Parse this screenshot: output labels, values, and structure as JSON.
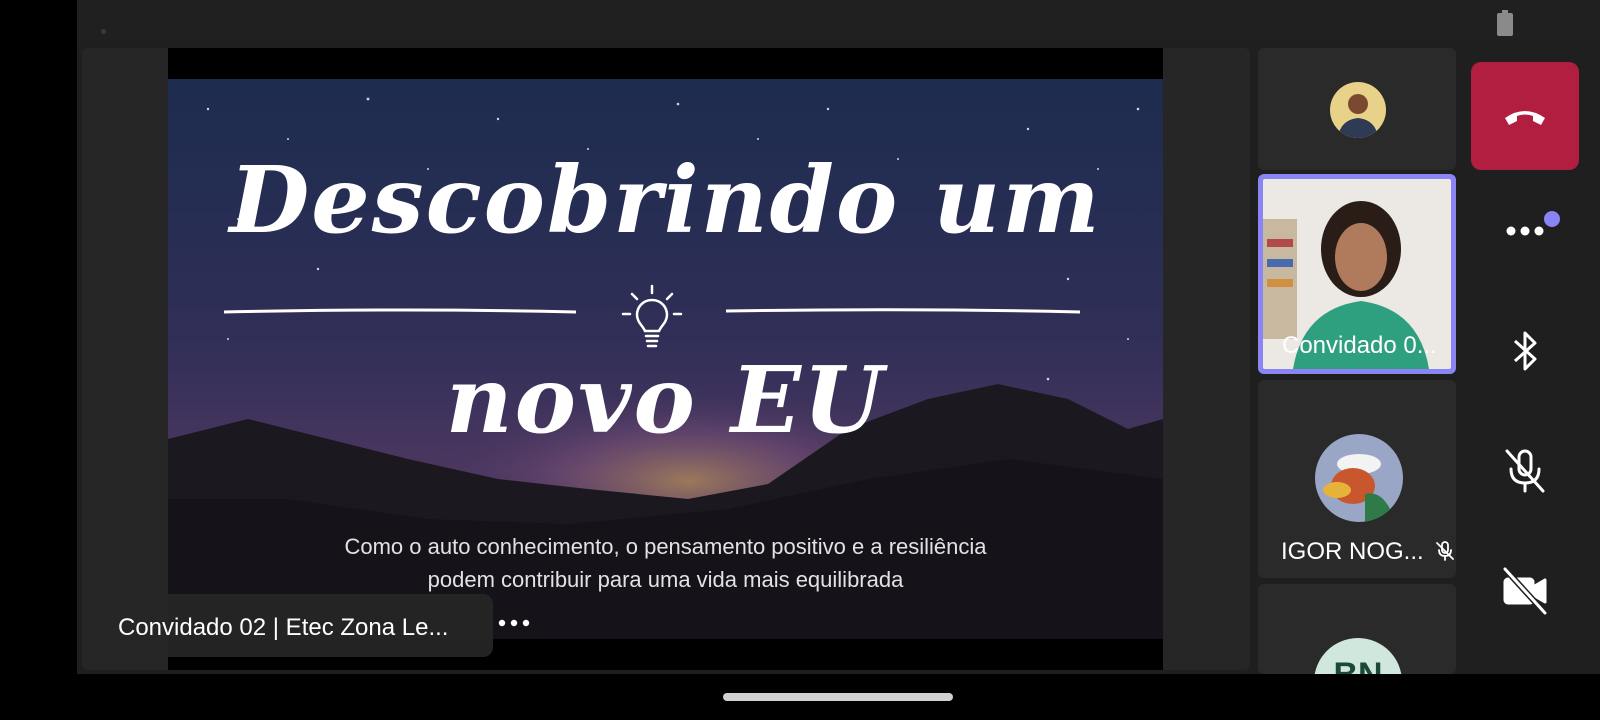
{
  "slide": {
    "title_line1": "Descobrindo um",
    "title_line2": "novo EU",
    "subtitle_line1": "Como o auto conhecimento, o pensamento positivo e a resiliência",
    "subtitle_line2": "podem contribuir para uma vida mais equilibrada",
    "icon": "lightbulb-icon"
  },
  "presenter": {
    "name": "Convidado 02 | Etec Zona Le...",
    "more_icon": "more-horizontal-icon"
  },
  "participants": [
    {
      "name": "",
      "type": "avatar-photo"
    },
    {
      "name": "Convidado 0...",
      "type": "video",
      "active_speaker": true
    },
    {
      "name": "IGOR NOG...",
      "type": "avatar-photo",
      "muted": true
    },
    {
      "name": "",
      "type": "avatar-initials",
      "initials": "BN"
    }
  ],
  "controls": {
    "hangup_icon": "phone-hangup-icon",
    "more_icon": "more-horizontal-icon",
    "bluetooth_icon": "bluetooth-icon",
    "mic_icon": "mic-off-icon",
    "camera_icon": "camera-off-icon"
  },
  "colors": {
    "hangup": "#b11e3f",
    "active_speaker_border": "#8b84f4",
    "background": "#1f1f1f",
    "tile": "#2a2a2a"
  }
}
